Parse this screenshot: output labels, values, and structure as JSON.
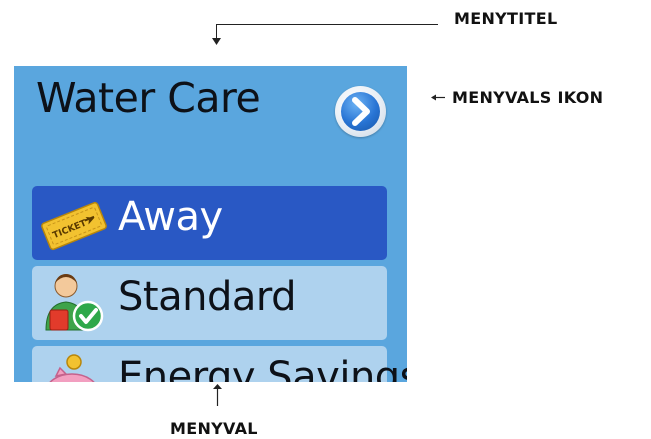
{
  "annotations": {
    "title_callout": "MENYTITEL",
    "icon_callout": "MENYVALS IKON",
    "item_callout": "MENYVAL"
  },
  "screen": {
    "title": "Water Care",
    "next_button_icon": "chevron-right-circle-icon",
    "colors": {
      "background": "#5aa6de",
      "selected_item": "#2958c4",
      "normal_item": "#aed2ee"
    },
    "menu": [
      {
        "label": "Away",
        "icon": "ticket-icon",
        "selected": true
      },
      {
        "label": "Standard",
        "icon": "person-check-icon",
        "selected": false
      },
      {
        "label": "Energy Savings",
        "icon": "piggy-bank-icon",
        "selected": false
      }
    ]
  }
}
